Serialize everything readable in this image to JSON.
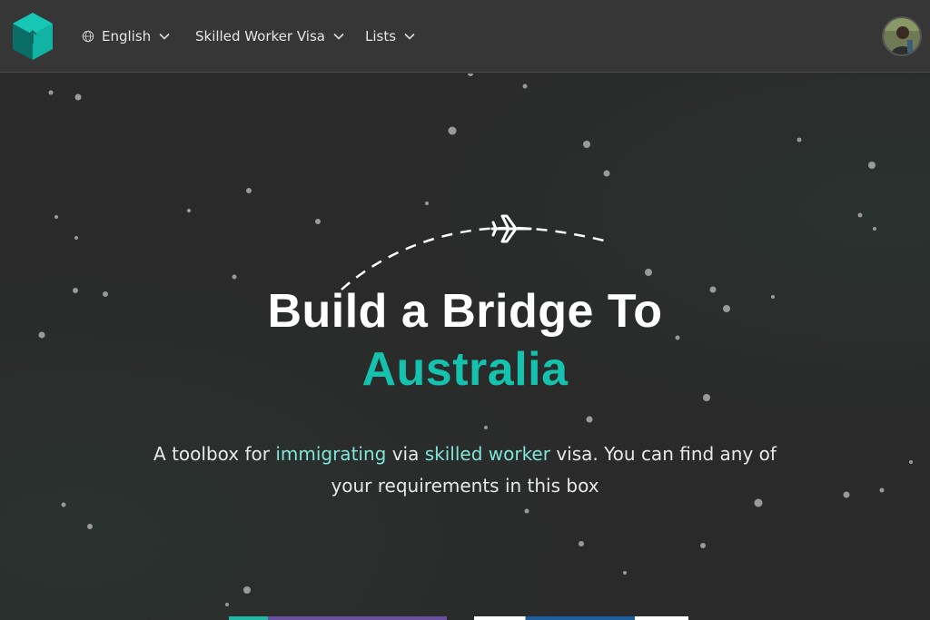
{
  "header": {
    "logo_icon": "hexagon-box-logo-icon",
    "language": {
      "label": "English",
      "icon": "globe-icon"
    },
    "menu": [
      {
        "label": "Skilled Worker Visa"
      },
      {
        "label": "Lists"
      }
    ],
    "avatar_icon": "user-avatar"
  },
  "hero": {
    "title_line1": "Build a Bridge To",
    "title_line2": "Australia",
    "subtitle_parts": {
      "a": "A toolbox for ",
      "b": "immigrating",
      "c": " via ",
      "d": "skilled worker",
      "e": " visa. You can find any of your requirements in this box"
    },
    "plane_icon": "airplane-icon"
  },
  "colors": {
    "accent": "#14c2ad",
    "highlight": "#7fe6d8",
    "background": "#2a2a2a",
    "header": "#363636"
  }
}
